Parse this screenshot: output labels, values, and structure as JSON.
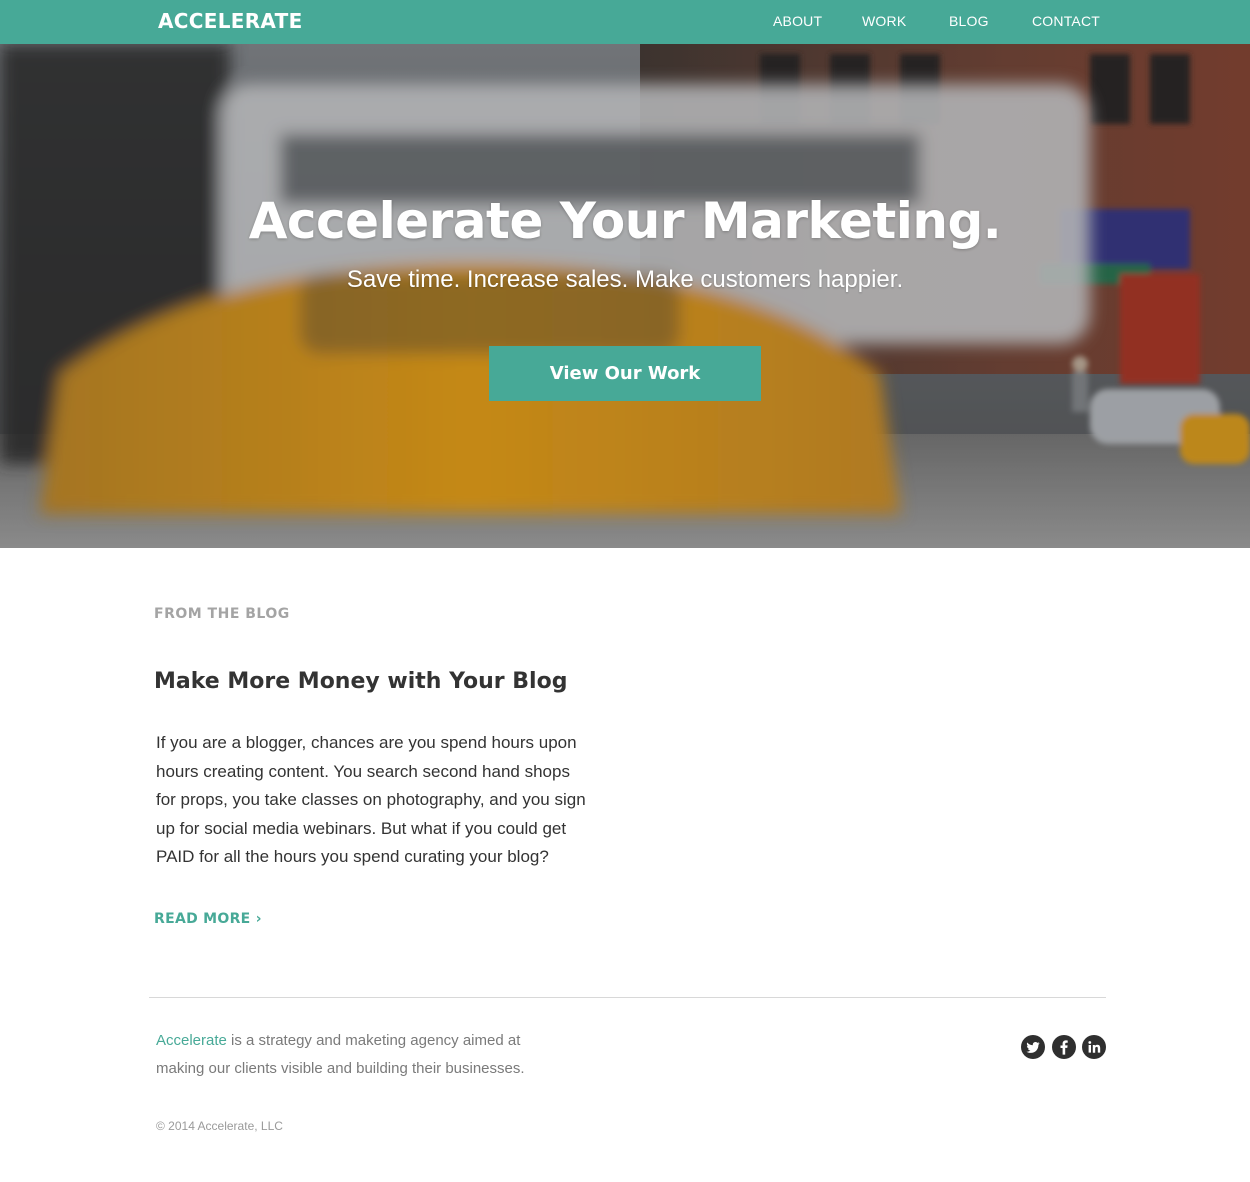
{
  "header": {
    "logo": "ACCELERATE",
    "nav": [
      "ABOUT",
      "WORK",
      "BLOG",
      "CONTACT"
    ]
  },
  "hero": {
    "title": "Accelerate Your Marketing.",
    "subtitle": "Save time. Increase sales. Make customers happier.",
    "button": "View Our Work"
  },
  "blog": {
    "section_label": "FROM THE BLOG",
    "post_title": "Make More Money with Your Blog",
    "post_body": "If you are a blogger, chances are you spend hours upon hours creating content. You search second hand shops for props, you take classes on photography, and you sign up for social media webinars. But what if you could get PAID for all the hours you spend curating your blog?",
    "read_more": "READ MORE ›"
  },
  "footer": {
    "brand": "Accelerate",
    "about_rest": " is a strategy and maketing agency aimed at making our clients visible and building their businesses.",
    "copyright": "© 2014 Accelerate, LLC",
    "social": [
      "twitter-icon",
      "facebook-icon",
      "linkedin-icon"
    ]
  },
  "colors": {
    "accent": "#47a997",
    "label_gray": "#a4a4a4",
    "text_dark": "#333333"
  }
}
